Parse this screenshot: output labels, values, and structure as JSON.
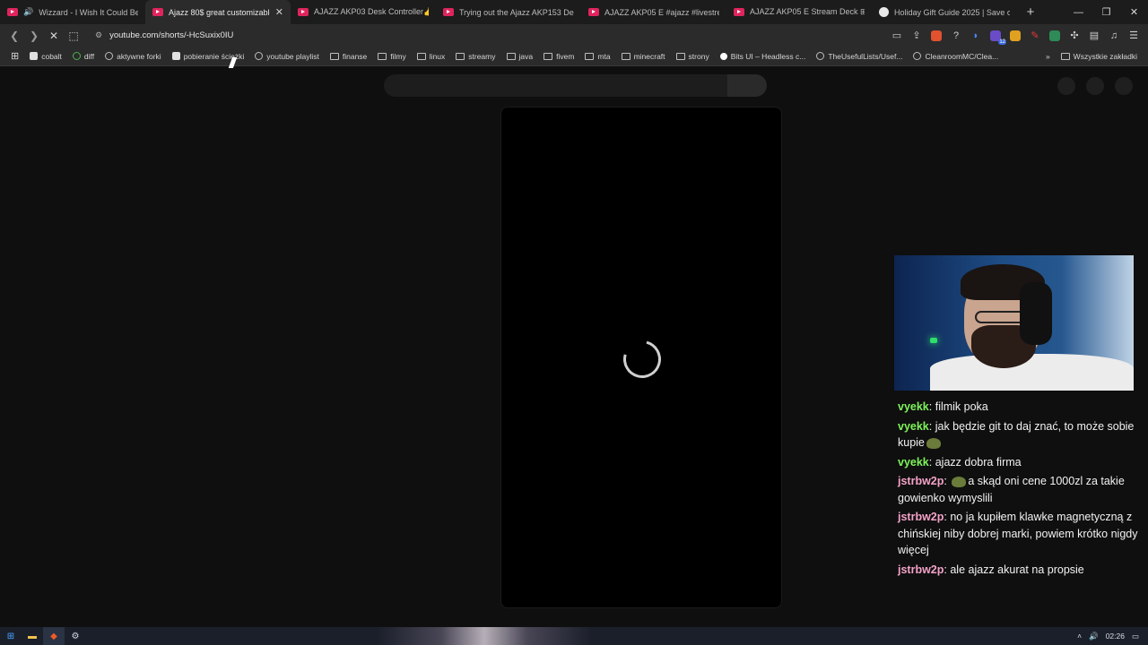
{
  "tabs": [
    {
      "title": "Wizzard - I Wish It Could Be Chr",
      "favicon": "youtube-icon",
      "audio": true,
      "active": false
    },
    {
      "title": "Ajazz 80$ great customizable st",
      "favicon": "youtube-icon",
      "audio": false,
      "active": true
    },
    {
      "title": "AJAZZ AKP03 Desk Controller👍 Spe",
      "favicon": "youtube-icon",
      "audio": false,
      "active": false
    },
    {
      "title": "Trying out the Ajazz AKP153 Desk C",
      "favicon": "youtube-icon",
      "audio": false,
      "active": false
    },
    {
      "title": "AJAZZ AKP05 E #ajazz #livestream #",
      "favicon": "youtube-icon",
      "audio": false,
      "active": false
    },
    {
      "title": "AJAZZ AKP05 E Stream Deck ⊞ | Ul",
      "favicon": "youtube-icon",
      "audio": false,
      "active": false
    },
    {
      "title": "Holiday Gift Guide 2025 | Save on El",
      "favicon": "globe-icon",
      "audio": false,
      "active": false
    }
  ],
  "toolbar": {
    "url": "youtube.com/shorts/-HcSuxix0IU",
    "ext_badge": "12"
  },
  "bookmarks": [
    {
      "label": "cobalt",
      "icon": "cobalt-icon"
    },
    {
      "label": "diff",
      "icon": "diff-icon"
    },
    {
      "label": "aktywne forki",
      "icon": "fork-icon"
    },
    {
      "label": "pobieranie ścieżki",
      "icon": "download-icon"
    },
    {
      "label": "youtube playlist",
      "icon": "globe-icon"
    },
    {
      "label": "finanse",
      "icon": "folder-icon"
    },
    {
      "label": "filmy",
      "icon": "folder-icon"
    },
    {
      "label": "linux",
      "icon": "folder-icon"
    },
    {
      "label": "streamy",
      "icon": "folder-icon"
    },
    {
      "label": "java",
      "icon": "folder-icon"
    },
    {
      "label": "fivem",
      "icon": "folder-icon"
    },
    {
      "label": "mta",
      "icon": "folder-icon"
    },
    {
      "label": "minecraft",
      "icon": "folder-icon"
    },
    {
      "label": "strony",
      "icon": "folder-icon"
    },
    {
      "label": "Bits UI – Headless c...",
      "icon": "bits-icon"
    },
    {
      "label": "TheUsefulLists/Usef...",
      "icon": "github-icon"
    },
    {
      "label": "CleanroomMC/Clea...",
      "icon": "github-icon"
    }
  ],
  "bookmarks_all": "Wszystkie zakładki",
  "chat": [
    {
      "nick": "vyekk",
      "text": "filmik poka",
      "color": "#7ef35a"
    },
    {
      "nick": "vyekk",
      "text": "jak będzie git to daj znać, to może sobie kupie",
      "emote_after": true,
      "color": "#7ef35a"
    },
    {
      "nick": "vyekk",
      "text": "ajazz dobra firma",
      "color": "#7ef35a"
    },
    {
      "nick": "jstrbw2p",
      "text": "a skąd oni cene 1000zl za takie gowienko wymyslili",
      "emote_before": true,
      "color": "#f4a2c8"
    },
    {
      "nick": "jstrbw2p",
      "text": "no ja kupiłem klawke magnetyczną z chińskiej niby dobrej marki, powiem krótko nigdy więcej",
      "color": "#f4a2c8"
    },
    {
      "nick": "jstrbw2p",
      "text": "ale ajazz akurat na propsie",
      "color": "#f4a2c8"
    }
  ],
  "taskbar": {
    "clock": "02:26"
  }
}
